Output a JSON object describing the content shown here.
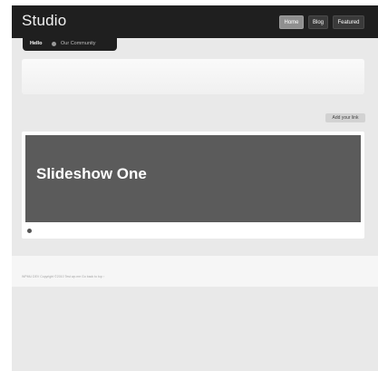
{
  "header": {
    "brand": "Studio",
    "nav": [
      {
        "label": "Home",
        "active": true
      },
      {
        "label": "Blog",
        "active": false
      },
      {
        "label": "Featured",
        "active": false
      }
    ]
  },
  "subnav": {
    "hello": "Hello",
    "link": "Our Community"
  },
  "actions": {
    "add_link": "Add your link"
  },
  "slideshow": {
    "title": "Slideshow One"
  },
  "footer": {
    "text": "WPMU DEV     Copyright ©2010 Test wp.me     Go back to top ↑"
  },
  "colors": {
    "topbar": "#1f1f1f",
    "page_background": "#e9e9e9",
    "slide_background": "#5b5b5b",
    "active_nav": "#8f8f8f"
  }
}
